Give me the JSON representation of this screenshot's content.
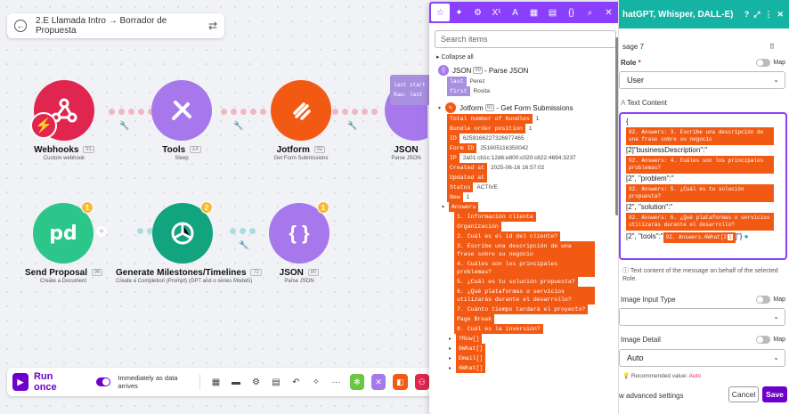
{
  "scenario": {
    "title": "2.E Llamada Intro → Borrador de Propuesta"
  },
  "modules": {
    "webhooks": {
      "name": "Webhooks",
      "num": "91",
      "sub": "Custom webhook"
    },
    "tools": {
      "name": "Tools",
      "num": "14",
      "sub": "Sleep"
    },
    "jotform": {
      "name": "Jotform",
      "num": "92",
      "sub": "Get Form Submissions"
    },
    "json_top": {
      "name": "JSON",
      "sub": "Parse JSON"
    },
    "send_proposal": {
      "name": "Send Proposal",
      "num": "96",
      "sub": "Create a Document",
      "badge": "1"
    },
    "generate": {
      "name": "Generate Milestones/Timelines",
      "num": "72",
      "sub": "Create a Completion (Prompt) (GPT and o series Models)",
      "badge": "2"
    },
    "json_bottom": {
      "name": "JSON",
      "num": "80",
      "sub": "Parse JSON",
      "badge": "1"
    }
  },
  "tooltip": {
    "line1": "last start",
    "line2": "Raw: last"
  },
  "toolbar": {
    "run_label": "Run once",
    "schedule_label": "Immediately as data arrives"
  },
  "mapper": {
    "search_placeholder": "Search items",
    "collapse_all": "Collapse all",
    "json_node": {
      "num": "99",
      "label": "JSON",
      "sub": "- Parse JSON"
    },
    "json_fields": [
      {
        "key": "last",
        "value": "Perez"
      },
      {
        "key": "first",
        "value": "Rosita"
      }
    ],
    "jotform_node": {
      "num": "92",
      "label": "Jotform",
      "sub": "- Get Form Submissions"
    },
    "jotform_fields": [
      {
        "key": "Total number of bundles",
        "value": "1"
      },
      {
        "key": "Bundle order position",
        "value": "1"
      },
      {
        "key": "ID",
        "value": "6259166227326977465"
      },
      {
        "key": "Form ID",
        "value": "251605116350042"
      },
      {
        "key": "IP",
        "value": "2a01:cb1c:12d6:e800:c020:c822:4694:3237"
      },
      {
        "key": "Created at",
        "value": "2025-06-16 16:57:02"
      },
      {
        "key": "Updated at",
        "value": ""
      },
      {
        "key": "Status",
        "value": "ACTIVE"
      },
      {
        "key": "New",
        "value": "1"
      }
    ],
    "answers_label": "Answers",
    "answers": [
      "1. Información cliente",
      "Organización",
      "2. Cuál es el id del cliente?",
      "3. Escribe una descripción de una frase sobre su negocio",
      "4. Cuáles son los principales problemas?",
      "5. ¿Cuál es tu solución propuesta?",
      "6. ¿Qué plataformas o servicios utilizarás durante el desarrollo?",
      "7. Cuánto tiempo tardará el proyecto?",
      "Page Break",
      "8. Cuál es la inversión?"
    ],
    "sub_items": [
      "?Row[]",
      "6What[]",
      "Email[]",
      "6What[]"
    ]
  },
  "settings": {
    "header_title": "hatGPT, Whisper, DALL-E)",
    "message_label": "sage 7",
    "role_label": "Role",
    "role_value": "User",
    "text_content_label": "Text Content",
    "map_label": "Map",
    "content": {
      "open": "{",
      "p1": "92. Answers: 3. Escribe una descripción de una frase sobre su negocio",
      "t1": "[2]\"businessDescription\":\"",
      "p2": "92. Answers: 4. Cuáles son los principales problemas?",
      "t2": "[2\", \"problem\":\"",
      "p3": "92. Answers: 5. ¿Cuál es tu solución propuesta?",
      "t3": "[2\", \"solution\":\"",
      "p4": "92. Answers: 6. ¿Qué plataformas o servicios utilizarás durante el desarrollo?",
      "t4a": "[2\", \"tools\":\"",
      "p5": "92. Answers.6What[",
      "t4b": "2",
      "idx": "1",
      "t4c": "]\"}"
    },
    "help_text": "Text content of the message on behalf of the selected Role.",
    "image_input_label": "Image Input Type",
    "image_detail_label": "Image Detail",
    "image_detail_value": "Auto",
    "recommended_label": "Recommended value:",
    "recommended_value": "Auto",
    "advanced_label": "w advanced settings",
    "cancel_label": "Cancel",
    "save_label": "Save"
  }
}
